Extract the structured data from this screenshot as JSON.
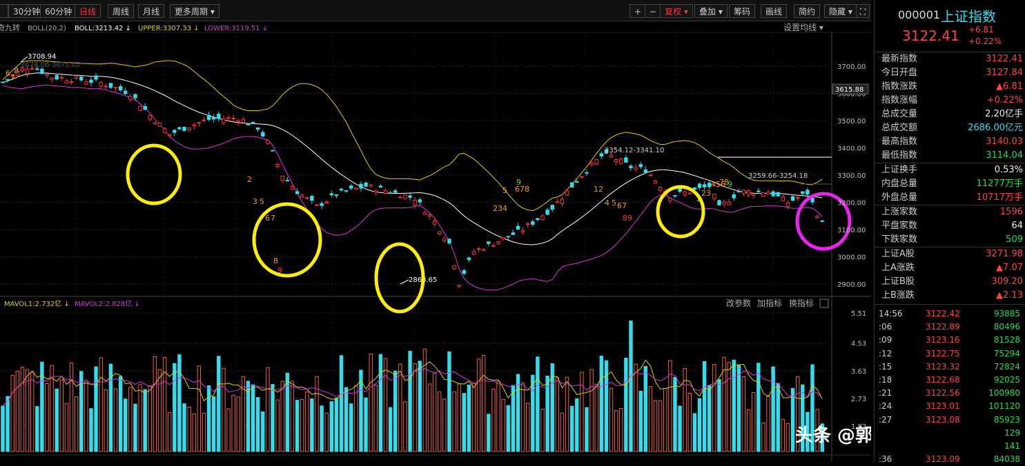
{
  "toolbar": {
    "period_tabs": [
      "30分钟",
      "60分钟",
      "日线",
      "周线",
      "月线",
      "更多周期"
    ],
    "active_tab": "日线",
    "right_buttons": [
      "+",
      "−",
      "复权",
      "叠加",
      "筹码",
      "画线",
      "简约",
      "隐藏"
    ]
  },
  "indicator_bar": {
    "name": "奇九转",
    "boll": "BOLL(20,2)",
    "boll_value": "BOLL:3213.42",
    "upper": "UPPER:3307.33",
    "lower": "LOWER:3119.51",
    "settings_label": "设置均线"
  },
  "price_axis": [
    "3700.00",
    "3600.00",
    "3500.00",
    "3400.00",
    "3300.00",
    "3200.00",
    "3100.00",
    "3000.00",
    "2900.00"
  ],
  "price_marker": "3615.88",
  "annotations": {
    "high_peak": "3708.94",
    "low_trough": "2863.65",
    "range_mid": "3354.12-3341.10",
    "range_right": "3259.66-3254.18",
    "ghost_label": "3678.06-3675.02"
  },
  "td_labels": [
    {
      "t": "6",
      "c": "#ff9900"
    },
    {
      "t": "7",
      "c": "#ff9900"
    },
    {
      "t": "8",
      "c": "#ff9900"
    },
    {
      "t": "2",
      "c": "#ff9900"
    },
    {
      "t": "3",
      "c": "#ff9900"
    },
    {
      "t": "5",
      "c": "#ff9900"
    },
    {
      "t": "6",
      "c": "#ff9900"
    },
    {
      "t": "7",
      "c": "#ff9900"
    },
    {
      "t": "8",
      "c": "#ff9900"
    },
    {
      "t": "9",
      "c": "#ff3333"
    },
    {
      "t": "234",
      "c": "#ff9900"
    },
    {
      "t": "5",
      "c": "#ff9900"
    },
    {
      "t": "678",
      "c": "#ff9900"
    },
    {
      "t": "9",
      "c": "#44dd44"
    },
    {
      "t": "12",
      "c": "#ff9900"
    },
    {
      "t": "4",
      "c": "#ff9900"
    },
    {
      "t": "5",
      "c": "#ff9900"
    },
    {
      "t": "67",
      "c": "#ff9900"
    },
    {
      "t": "89",
      "c": "#ff3333"
    },
    {
      "t": "1",
      "c": "#ff9900"
    },
    {
      "t": "23",
      "c": "#ff9900"
    },
    {
      "t": "456",
      "c": "#ff9900"
    },
    {
      "t": "78",
      "c": "#ff9900"
    },
    {
      "t": "9",
      "c": "#44dd44"
    }
  ],
  "volume_bar": {
    "mavol1": "MAVOL1:2.732亿",
    "mavol2": "MAVOL2:2.828亿",
    "buttons": [
      "改参数",
      "加指标",
      "换指标"
    ]
  },
  "volume_axis": [
    "5.51",
    "4.53",
    "3.63",
    "2.73",
    "1.83"
  ],
  "watermark": "头条 @郭腾云财经",
  "sidebar": {
    "code": "000001",
    "name": "上证指数",
    "price": "3122.41",
    "change": "+6.81",
    "change_pct": "+0.22%",
    "quote_rows": [
      {
        "k": "最新指数",
        "v": "3122.41",
        "c": "red"
      },
      {
        "k": "今日开盘",
        "v": "3127.84",
        "c": "red"
      },
      {
        "k": "指数涨跌",
        "v": "▲6.81",
        "c": "red"
      },
      {
        "k": "指数涨幅",
        "v": "+0.22%",
        "c": "red"
      },
      {
        "k": "总成交量",
        "v": "2.20亿手",
        "c": "white"
      },
      {
        "k": "总成交额",
        "v": "2686.00亿元",
        "c": "cyan"
      },
      {
        "k": "最高指数",
        "v": "3140.03",
        "c": "red"
      },
      {
        "k": "最低指数",
        "v": "3114.04",
        "c": "green"
      }
    ],
    "turnover_rows": [
      {
        "k": "上证换手",
        "v": "0.53%",
        "c": "white"
      },
      {
        "k": "内盘总量",
        "v": "11277万手",
        "c": "green"
      },
      {
        "k": "外盘总量",
        "v": "10717万手",
        "c": "red"
      }
    ],
    "breadth_rows": [
      {
        "k": "上涨家数",
        "v": "1596",
        "c": "red"
      },
      {
        "k": "平盘家数",
        "v": "64",
        "c": "white"
      },
      {
        "k": "下跌家数",
        "v": "509",
        "c": "green"
      }
    ],
    "ab_rows": [
      {
        "k": "上证A股",
        "v": "3271.98",
        "c": "red"
      },
      {
        "k": "上A涨跌",
        "v": "▲7.07",
        "c": "red"
      },
      {
        "k": "上证B股",
        "v": "309.20",
        "c": "red"
      },
      {
        "k": "上B涨跌",
        "v": "▲2.13",
        "c": "red"
      }
    ],
    "ticks": [
      {
        "t": "14:56",
        "p": "3122.42",
        "v": "93885"
      },
      {
        "t": ":06",
        "p": "3122.89",
        "v": "80496"
      },
      {
        "t": ":09",
        "p": "3123.16",
        "v": "81528"
      },
      {
        "t": ":12",
        "p": "3122.75",
        "v": "75294"
      },
      {
        "t": ":15",
        "p": "3123.32",
        "v": "72824"
      },
      {
        "t": ":18",
        "p": "3122.68",
        "v": "92025"
      },
      {
        "t": ":21",
        "p": "3122.56",
        "v": "100980"
      },
      {
        "t": ":24",
        "p": "3123.01",
        "v": "101120"
      },
      {
        "t": ":27",
        "p": "3123.08",
        "v": "85923"
      },
      {
        "t": "",
        "p": "",
        "v": "129"
      },
      {
        "t": "",
        "p": "",
        "v": "141"
      },
      {
        "t": ":36",
        "p": "3123.09",
        "v": "84038"
      }
    ]
  },
  "colors": {
    "up": "#ff3333",
    "down": "#33ddee",
    "boll_mid": "#ffffff",
    "boll_upper": "#e0d000",
    "boll_lower": "#dd33dd",
    "highlight_yellow": "#ffee00",
    "highlight_magenta": "#ee22ee"
  }
}
